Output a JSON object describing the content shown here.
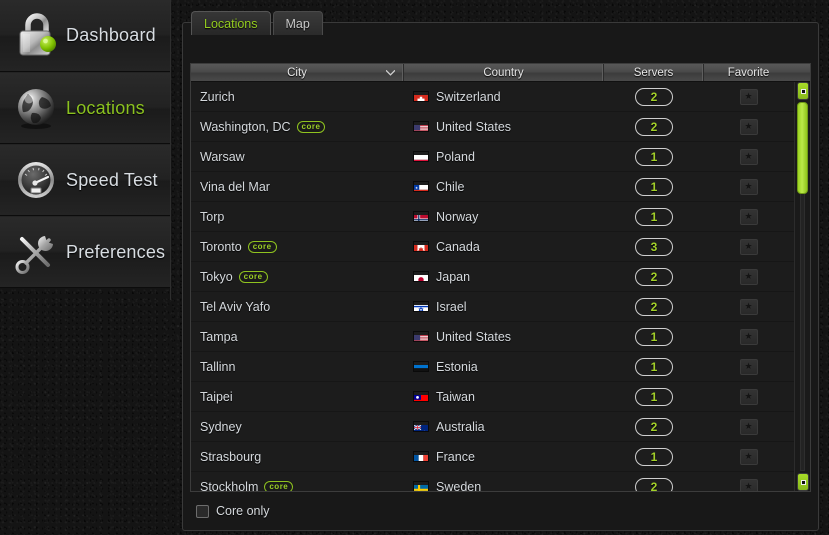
{
  "app": {
    "background_color": "#141414",
    "accent_color": "#93cb1f"
  },
  "sidebar": {
    "items": [
      {
        "label": "Dashboard",
        "icon": "padlock-icon",
        "active": false
      },
      {
        "label": "Locations",
        "icon": "globe-icon",
        "active": true
      },
      {
        "label": "Speed Test",
        "icon": "speedometer-icon",
        "active": false
      },
      {
        "label": "Preferences",
        "icon": "tools-icon",
        "active": false
      }
    ]
  },
  "main": {
    "tabs": [
      {
        "label": "Locations",
        "active": true
      },
      {
        "label": "Map",
        "active": false
      }
    ],
    "table": {
      "columns": [
        {
          "key": "city",
          "label": "City",
          "sorted": true,
          "sort_direction": "asc"
        },
        {
          "key": "country",
          "label": "Country",
          "sorted": false
        },
        {
          "key": "servers",
          "label": "Servers",
          "sorted": false
        },
        {
          "key": "favorite",
          "label": "Favorite",
          "sorted": false
        }
      ],
      "rows": [
        {
          "city": "Zurich",
          "core": false,
          "country": "Switzerland",
          "flag": "ch",
          "servers": "2",
          "favorite": false
        },
        {
          "city": "Washington, DC",
          "core": true,
          "country": "United States",
          "flag": "us",
          "servers": "2",
          "favorite": false
        },
        {
          "city": "Warsaw",
          "core": false,
          "country": "Poland",
          "flag": "pl",
          "servers": "1",
          "favorite": false
        },
        {
          "city": "Vina del Mar",
          "core": false,
          "country": "Chile",
          "flag": "cl",
          "servers": "1",
          "favorite": false
        },
        {
          "city": "Torp",
          "core": false,
          "country": "Norway",
          "flag": "no",
          "servers": "1",
          "favorite": false
        },
        {
          "city": "Toronto",
          "core": true,
          "country": "Canada",
          "flag": "ca",
          "servers": "3",
          "favorite": false
        },
        {
          "city": "Tokyo",
          "core": true,
          "country": "Japan",
          "flag": "jp",
          "servers": "2",
          "favorite": false
        },
        {
          "city": "Tel Aviv Yafo",
          "core": false,
          "country": "Israel",
          "flag": "il",
          "servers": "2",
          "favorite": false
        },
        {
          "city": "Tampa",
          "core": false,
          "country": "United States",
          "flag": "us",
          "servers": "1",
          "favorite": false
        },
        {
          "city": "Tallinn",
          "core": false,
          "country": "Estonia",
          "flag": "ee",
          "servers": "1",
          "favorite": false
        },
        {
          "city": "Taipei",
          "core": false,
          "country": "Taiwan",
          "flag": "tw",
          "servers": "1",
          "favorite": false
        },
        {
          "city": "Sydney",
          "core": false,
          "country": "Australia",
          "flag": "au",
          "servers": "2",
          "favorite": false
        },
        {
          "city": "Strasbourg",
          "core": false,
          "country": "France",
          "flag": "fr",
          "servers": "1",
          "favorite": false
        },
        {
          "city": "Stockholm",
          "core": true,
          "country": "Sweden",
          "flag": "se",
          "servers": "2",
          "favorite": false
        }
      ],
      "core_badge_label": "core",
      "favorite_icon": "star-icon"
    },
    "filter": {
      "core_only_label": "Core only",
      "core_only_checked": false
    },
    "scrollbar": {
      "up_arrow_icon": "scroll-up-arrow",
      "down_arrow_icon": "scroll-down-arrow",
      "thumb_position": "top"
    }
  }
}
